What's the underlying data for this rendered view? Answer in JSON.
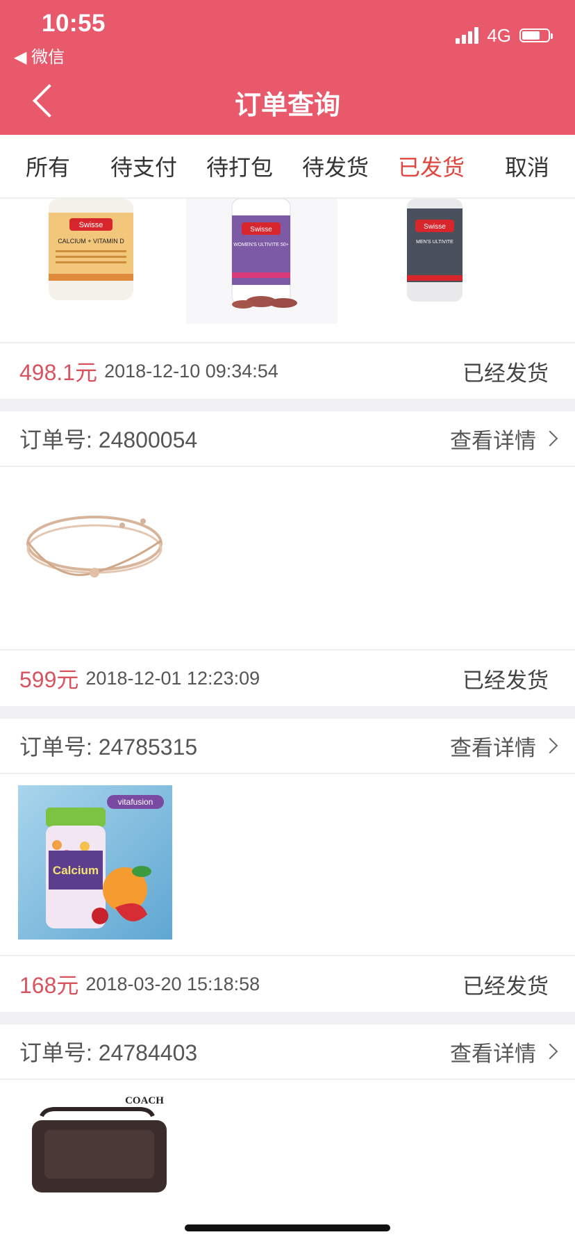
{
  "status_bar": {
    "time": "10:55",
    "back_app": "◀ 微信",
    "network": "4G"
  },
  "nav": {
    "title": "订单查询"
  },
  "tabs": [
    {
      "label": "所有",
      "active": false
    },
    {
      "label": "待支付",
      "active": false
    },
    {
      "label": "待打包",
      "active": false
    },
    {
      "label": "待发货",
      "active": false
    },
    {
      "label": "已发货",
      "active": true
    },
    {
      "label": "取消",
      "active": false
    }
  ],
  "colors": {
    "header": "#e9596c",
    "active_tab": "#e0463e",
    "price": "#d9535f"
  },
  "orders": [
    {
      "order_no_label": "",
      "price": "498.1元",
      "date": "2018-12-10 09:34:54",
      "status": "已经发货",
      "products": [
        {
          "brand": "Swisse",
          "name": "CALCIUM + VITAMIN D"
        },
        {
          "brand": "Swisse",
          "name": "WOMEN'S ULTIVITE 50+"
        },
        {
          "brand": "Swisse",
          "name": "MEN'S ULTIVITE"
        }
      ]
    },
    {
      "order_no_label": "订单号: 24800054",
      "details_label": "查看详情",
      "price": "599元",
      "date": "2018-12-01 12:23:09",
      "status": "已经发货",
      "products": [
        {
          "name": "bracelet-icon"
        }
      ]
    },
    {
      "order_no_label": "订单号: 24785315",
      "details_label": "查看详情",
      "price": "168元",
      "date": "2018-03-20 15:18:58",
      "status": "已经发货",
      "products": [
        {
          "brand": "vitafusion",
          "name": "Calcium"
        }
      ]
    },
    {
      "order_no_label": "订单号: 24784403",
      "details_label": "查看详情",
      "products": [
        {
          "brand": "COACH",
          "name": "bag-icon"
        }
      ]
    }
  ]
}
